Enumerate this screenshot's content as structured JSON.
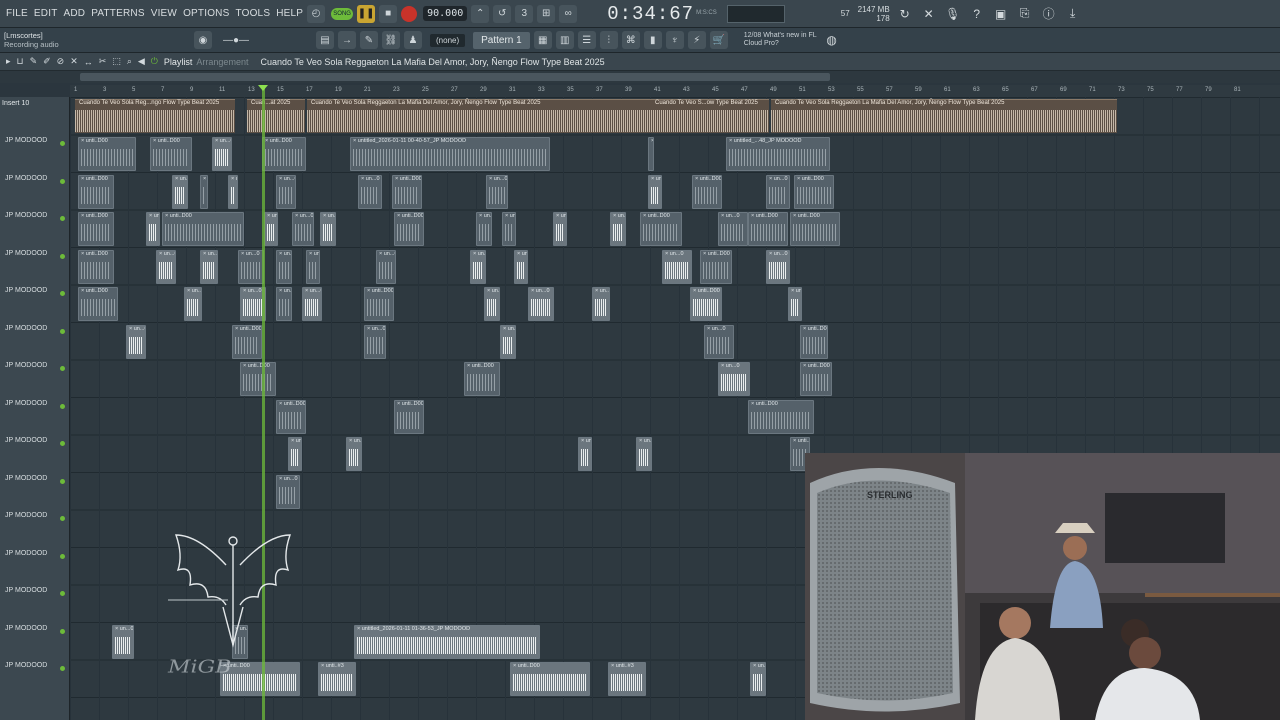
{
  "menu": [
    "FILE",
    "EDIT",
    "ADD",
    "PATTERNS",
    "VIEW",
    "OPTIONS",
    "TOOLS",
    "HELP"
  ],
  "transport": {
    "song_label": "SONG",
    "tempo": "90.000",
    "time": "0:34:67",
    "time_sub": "M:S:CS"
  },
  "monitor": {
    "cpu": "57",
    "ram": "2147 MB",
    "voices": "178"
  },
  "hint": {
    "title": "[Lmscortes]",
    "text": "Recording audio"
  },
  "pattern": "Pattern 1",
  "channel_select": "(none)",
  "news": {
    "date": "12/08",
    "line1": "What's new in FL",
    "line2": "Cloud Pro?"
  },
  "playlist": {
    "label": "Playlist",
    "arrangement": "Arrangement",
    "song": "Cuando Te Veo Sola  Reggaeton  La Mafia Del Amor, Jory, Ñengo Flow Type Beat 2025"
  },
  "insert": "Insert 10",
  "ruler": [
    "1",
    "3",
    "5",
    "7",
    "9",
    "11",
    "13",
    "15",
    "17",
    "19",
    "21",
    "23",
    "25",
    "27",
    "29",
    "31",
    "33",
    "35",
    "37",
    "39",
    "41",
    "43",
    "45",
    "47",
    "49",
    "51",
    "53",
    "55",
    "57",
    "59",
    "61",
    "63",
    "65",
    "67",
    "69",
    "71",
    "73",
    "75",
    "77",
    "79",
    "81"
  ],
  "ref_clips": [
    {
      "label": "Cuando Te Veo Sola  Reg...ngo Flow Type Beat 2025"
    },
    {
      "label": "Cuan...at 2025"
    },
    {
      "label": "Cuando Te Veo Sola  Reggaeton  La Mafia Del Amor, Jory, Ñengo Flow Type Beat 2025"
    },
    {
      "label": "Cuando Te Veo S...ow Type Beat 2025"
    },
    {
      "label": "Cuando Te Veo Sola  Reggaeton  La Mafia Del Amor, Jory, Ñengo Flow Type Beat 2025"
    }
  ],
  "tracks": [
    "JP MODOOD",
    "JP MODOOD",
    "JP MODOOD",
    "JP MODOOD",
    "JP MODOOD",
    "JP MODOOD",
    "JP MODOOD",
    "JP MODOOD",
    "JP MODOOD",
    "JP MODOOD",
    "JP MODOOD",
    "JP MODOOD",
    "JP MODOOD",
    "JP MODOOD",
    "JP MODOOD"
  ],
  "clip_labels": {
    "long1": "untitled_2026-01-11 00-40-57_JP MODOOD",
    "long2": "untitled_2026-01-11 01-36-53_JP MODOOD",
    "short": "unti..D00",
    "short2": "untitled_...48_JP MODOOD",
    "tiny": "un...0",
    "three": "unti..#3"
  },
  "webcam_brand": "STERLING"
}
